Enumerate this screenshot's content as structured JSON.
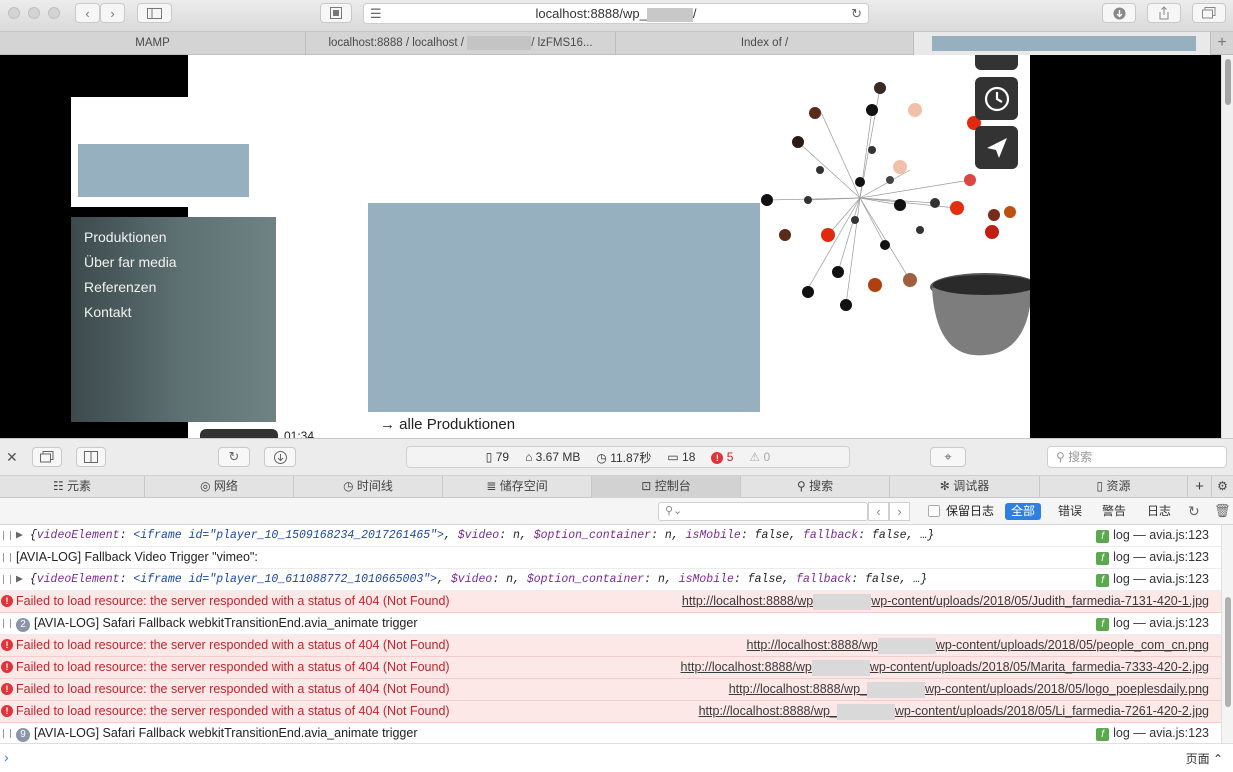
{
  "toolbar": {
    "url": "localhost:8888/wp_",
    "url_suffix": "/"
  },
  "tabs": [
    {
      "label": "MAMP"
    },
    {
      "label": "localhost:8888 / localhost /",
      "suffix": "/ lzFMS16..."
    },
    {
      "label": "Index of /"
    }
  ],
  "page": {
    "menu": [
      "Produktionen",
      "Über far media",
      "Referenzen",
      "Kontakt"
    ],
    "video_time": "01:34",
    "all_productions_arrow": "→",
    "all_productions": "alle Produktionen"
  },
  "devtools": {
    "stats": {
      "resources": "79",
      "size": "3.67 MB",
      "time": "11.87秒",
      "logs": "18",
      "errors": "5",
      "warnings": "0"
    },
    "search_placeholder": "搜索",
    "tabs": [
      "元素",
      "网络",
      "时间线",
      "储存空间",
      "控制台",
      "搜索",
      "调试器",
      "资源"
    ],
    "active_tab": "控制台",
    "filter": {
      "preserve_log": "保留日志",
      "all": "全部",
      "errors": "错误",
      "warnings": "警告",
      "logs": "日志"
    },
    "console": [
      {
        "type": "log-obj",
        "id": "player_10_1509168234_2017261465",
        "source": "log — avia.js:123"
      },
      {
        "type": "log",
        "text": "[AVIA-LOG] Fallback Video Trigger \"vimeo\":",
        "source": "log — avia.js:123"
      },
      {
        "type": "log-obj",
        "id": "player_10_611088772_1010665003",
        "source": "log — avia.js:123"
      },
      {
        "type": "error",
        "text": "Failed to load resource: the server responded with a status of 404 (Not Found)",
        "url_a": "http://localhost:8888/wp",
        "url_b": "wp-content/uploads/2018/05/Judith_farmedia-7131-420-1.jpg"
      },
      {
        "type": "log",
        "badge": "2",
        "text": "[AVIA-LOG] Safari Fallback webkitTransitionEnd.avia_animate trigger",
        "source": "log — avia.js:123"
      },
      {
        "type": "error",
        "text": "Failed to load resource: the server responded with a status of 404 (Not Found)",
        "url_a": "http://localhost:8888/wp",
        "url_b": "wp-content/uploads/2018/05/people_com_cn.png"
      },
      {
        "type": "error",
        "text": "Failed to load resource: the server responded with a status of 404 (Not Found)",
        "url_a": "http://localhost:8888/wp",
        "url_b": "wp-content/uploads/2018/05/Marita_farmedia-7333-420-2.jpg"
      },
      {
        "type": "error",
        "text": "Failed to load resource: the server responded with a status of 404 (Not Found)",
        "url_a": "http://localhost:8888/wp_",
        "url_b": "wp-content/uploads/2018/05/logo_poeplesdaily.png"
      },
      {
        "type": "error",
        "text": "Failed to load resource: the server responded with a status of 404 (Not Found)",
        "url_a": "http://localhost:8888/wp_",
        "url_b": "wp-content/uploads/2018/05/Li_farmedia-7261-420-2.jpg"
      },
      {
        "type": "log",
        "badge": "9",
        "text": "[AVIA-LOG] Safari Fallback webkitTransitionEnd.avia_animate trigger",
        "source": "log — avia.js:123"
      }
    ],
    "obj_template": {
      "k1": "videoElement",
      "tag": "<iframe id=",
      "k2": "$video",
      "k3": "$option_container",
      "k4": "isMobile",
      "k5": "fallback",
      "n": "n",
      "f": "false",
      "ell": "…"
    },
    "prompt_right": "页面 ⌃"
  },
  "colors": {
    "error_bg": "#fde8e8",
    "error_text": "#c0262c",
    "active_filter": "#2f7fe2",
    "placeholder_block": "#97b0bf",
    "menu_panel": "#4a5a5c"
  }
}
